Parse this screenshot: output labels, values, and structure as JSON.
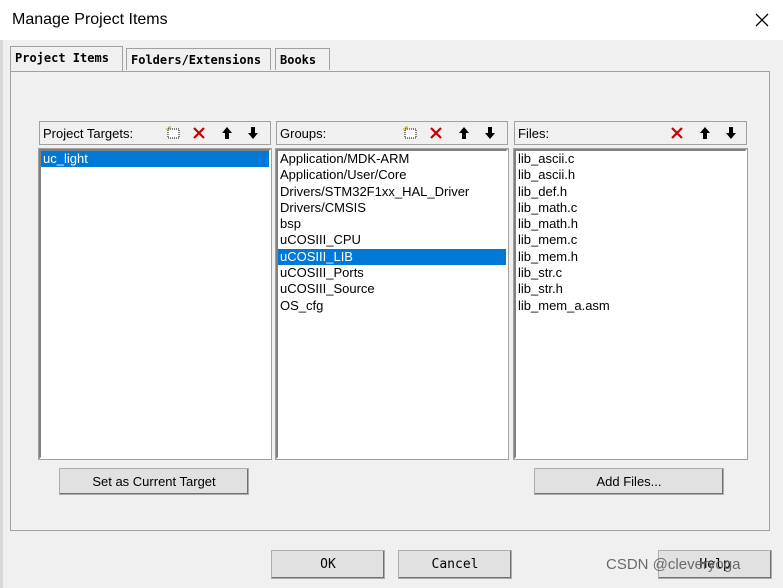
{
  "window": {
    "title": "Manage Project Items"
  },
  "tabs": [
    {
      "label": "Project Items"
    },
    {
      "label": "Folders/Extensions"
    },
    {
      "label": "Books"
    }
  ],
  "targets": {
    "label": "Project Targets:",
    "items": [
      "uc_light"
    ],
    "selected_index": 0
  },
  "groups": {
    "label": "Groups:",
    "items": [
      "Application/MDK-ARM",
      "Application/User/Core",
      "Drivers/STM32F1xx_HAL_Driver",
      "Drivers/CMSIS",
      "bsp",
      "uCOSIII_CPU",
      "uCOSIII_LIB",
      "uCOSIII_Ports",
      "uCOSIII_Source",
      "OS_cfg"
    ],
    "selected_index": 6
  },
  "files": {
    "label": "Files:",
    "items": [
      "lib_ascii.c",
      "lib_ascii.h",
      "lib_def.h",
      "lib_math.c",
      "lib_math.h",
      "lib_mem.c",
      "lib_mem.h",
      "lib_str.c",
      "lib_str.h",
      "lib_mem_a.asm"
    ]
  },
  "buttons": {
    "set_current_target": "Set as Current Target",
    "add_files": "Add Files...",
    "ok": "OK",
    "cancel": "Cancel",
    "help": "Help"
  },
  "watermark": "CSDN @cleveryoga",
  "colors": {
    "selection": "#0078d7",
    "delete_red": "#cc0000"
  }
}
